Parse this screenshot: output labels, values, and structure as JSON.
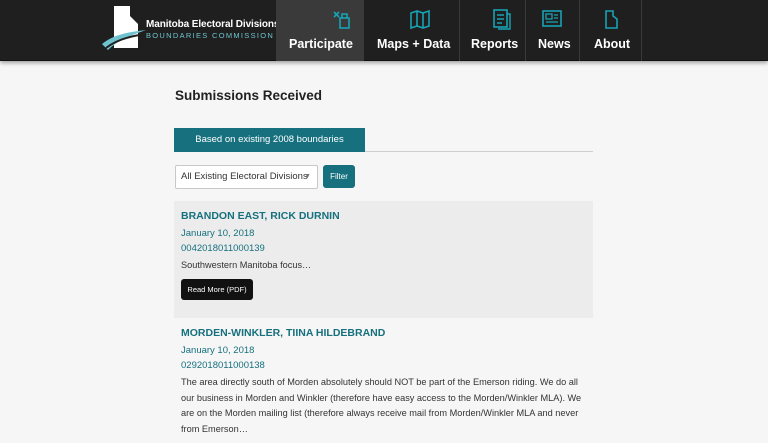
{
  "header": {
    "logo": {
      "line1": "Manitoba Electoral Divisions",
      "line2": "BOUNDARIES COMMISSION"
    },
    "nav": [
      {
        "label": "Participate",
        "icon": "participate-icon",
        "active": true
      },
      {
        "label": "Maps + Data",
        "icon": "map-icon",
        "active": false
      },
      {
        "label": "Reports",
        "icon": "document-icon",
        "active": false
      },
      {
        "label": "News",
        "icon": "newspaper-icon",
        "active": false
      },
      {
        "label": "About",
        "icon": "manitoba-outline-icon",
        "active": false
      }
    ]
  },
  "main": {
    "title": "Submissions Received",
    "tab_label": "Based on existing 2008 boundaries",
    "select_value": "All Existing Electoral Divisions",
    "filter_label": "Filter",
    "submissions": [
      {
        "title": "BRANDON EAST, RICK DURNIN",
        "date": "January 10, 2018",
        "id": "0042018011000139",
        "excerpt": "Southwestern Manitoba focus…",
        "button": "Read More (PDF)"
      },
      {
        "title": "MORDEN-WINKLER, TIINA HILDEBRAND",
        "date": "January 10, 2018",
        "id": "0292018011000138",
        "excerpt": "The area directly south of Morden absolutely should NOT be part of the Emerson riding. We do all our business in Morden and Winkler (therefore have easy access to the Morden/Winkler MLA). We are on the Morden mailing list (therefore always receive mail from Morden/Winkler MLA and never from Emerson…"
      }
    ]
  },
  "colors": {
    "header_bg": "#1f1f1f",
    "accent": "#16707e",
    "logo_sub": "#6ec3cf",
    "page_bg": "#f6f6f6"
  }
}
